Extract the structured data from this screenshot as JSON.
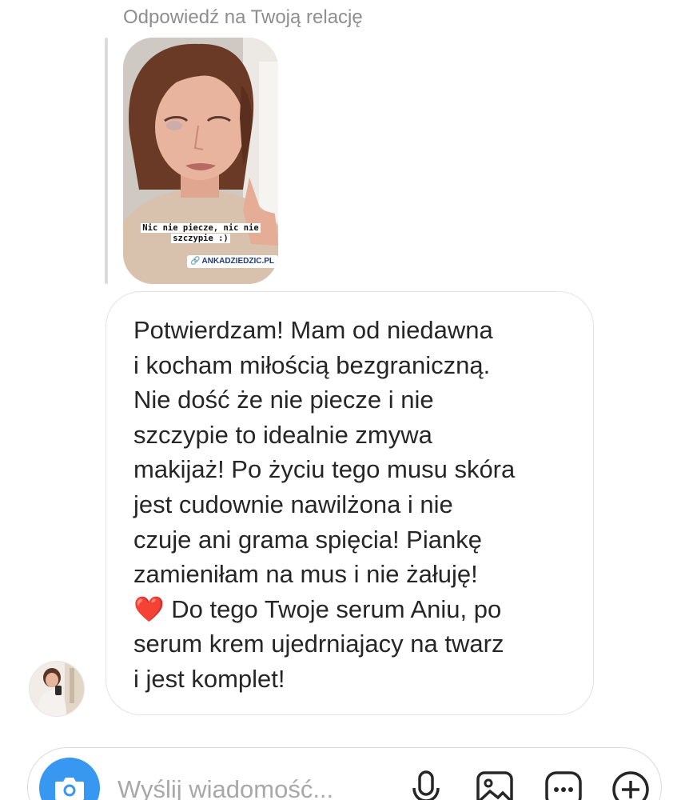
{
  "reply": {
    "label": "Odpowiedź na Twoją relację"
  },
  "story": {
    "caption_line1": "Nic nie piecze, nic nie",
    "caption_line2": "szczypie :)",
    "link_glyph": "🔗",
    "link_text": "ANKADZIEDZIC.PL"
  },
  "message": {
    "lines": [
      "Potwierdzam! Mam od niedawna",
      "i kocham miłością bezgraniczną.",
      "Nie dość że nie piecze i nie",
      "szczypie to idealnie zmywa",
      "makijaż! Po życiu tego musu skóra",
      "jest cudownie nawilżona i nie",
      "czuje ani grama spięcia! Piankę",
      "zamieniłam na mus i nie żałuję!",
      "❤️ Do tego Twoje serum Aniu, po",
      "serum krem ujedrniajacy na twarz",
      "i jest komplet!"
    ]
  },
  "composer": {
    "placeholder": "Wyślij wiadomość..."
  },
  "icons": {
    "camera": "camera-icon",
    "mic": "microphone-icon",
    "gallery": "gallery-icon",
    "sticker": "sticker-icon",
    "plus": "plus-icon"
  },
  "colors": {
    "accent": "#3897f0",
    "text": "#262626",
    "muted": "#8e8e8e",
    "border": "#dbdbdb",
    "heart": "#e0245e"
  }
}
